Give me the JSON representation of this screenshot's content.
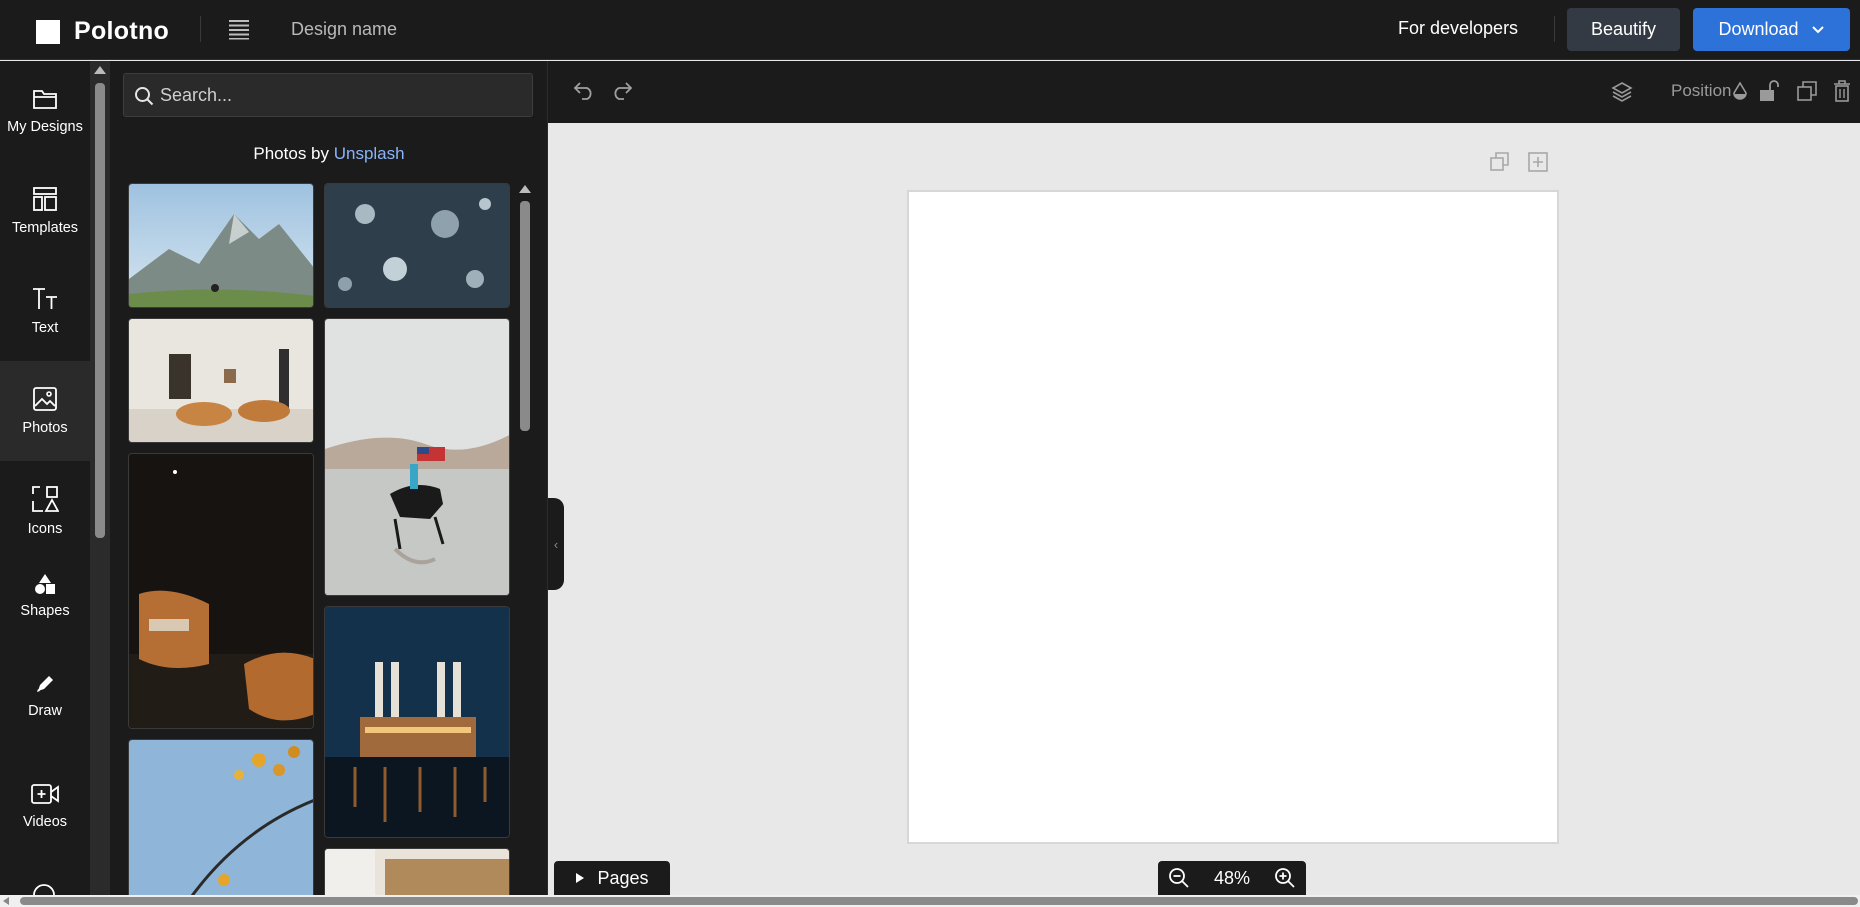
{
  "app": {
    "name": "Polotno",
    "design_name": "Design name"
  },
  "header": {
    "for_developers": "For developers",
    "beautify": "Beautify",
    "download": "Download"
  },
  "sidebar": {
    "items": [
      {
        "label": "My Designs",
        "icon": "folder-icon"
      },
      {
        "label": "Templates",
        "icon": "templates-icon"
      },
      {
        "label": "Text",
        "icon": "text-icon"
      },
      {
        "label": "Photos",
        "icon": "photo-icon",
        "active": true
      },
      {
        "label": "Icons",
        "icon": "icons-icon"
      },
      {
        "label": "Shapes",
        "icon": "shapes-icon"
      },
      {
        "label": "Draw",
        "icon": "pencil-icon"
      },
      {
        "label": "Videos",
        "icon": "video-icon"
      }
    ]
  },
  "photos_panel": {
    "search_placeholder": "Search...",
    "credit_prefix": "Photos by ",
    "credit_link": "Unsplash"
  },
  "toolbar": {
    "position_label": "Position"
  },
  "bottom": {
    "pages_label": "Pages",
    "zoom": "48%"
  },
  "colors": {
    "dark_bg": "#1b1b1b",
    "accent": "#2d72d9",
    "link": "#8ab4f8",
    "workspace": "#e8e8e8"
  }
}
